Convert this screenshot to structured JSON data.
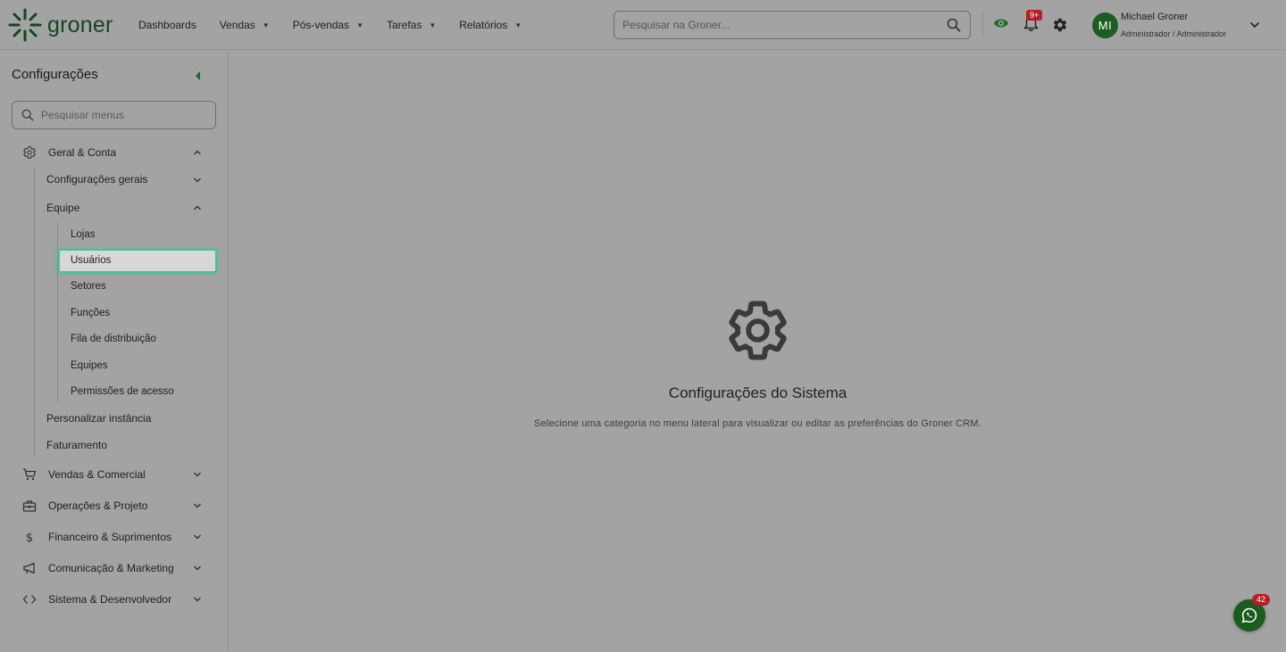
{
  "brand": {
    "name": "groner",
    "color": "#16461f"
  },
  "nav": {
    "items": [
      {
        "label": "Dashboards",
        "has_caret": false
      },
      {
        "label": "Vendas",
        "has_caret": true
      },
      {
        "label": "Pós-vendas",
        "has_caret": true
      },
      {
        "label": "Tarefas",
        "has_caret": true
      },
      {
        "label": "Relatórios",
        "has_caret": true
      }
    ]
  },
  "search": {
    "placeholder": "Pesquisar na Groner...",
    "icon": "search-icon"
  },
  "toolbar": {
    "notifications_badge": "9+",
    "icons": [
      "eye-icon",
      "bell-icon",
      "gear-icon"
    ]
  },
  "user": {
    "initials": "MI",
    "name": "Michael Groner",
    "role": "Administrador / Administrador"
  },
  "sidebar": {
    "title": "Configurações",
    "search_placeholder": "Pesquisar menus",
    "groups": [
      {
        "label": "Geral & Conta",
        "icon": "gear-icon",
        "expanded": true
      },
      {
        "label": "Vendas & Comercial",
        "icon": "cart-icon",
        "expanded": false
      },
      {
        "label": "Operações & Projeto",
        "icon": "toolbox-icon",
        "expanded": false
      },
      {
        "label": "Financeiro & Suprimentos",
        "icon": "dollar-icon",
        "expanded": false
      },
      {
        "label": "Comunicação & Marketing",
        "icon": "megaphone-icon",
        "expanded": false
      },
      {
        "label": "Sistema & Desenvolvedor",
        "icon": "code-icon",
        "expanded": false
      }
    ],
    "geral_sub": {
      "config_gerais": "Configurações gerais",
      "equipe": "Equipe",
      "personalizar": "Personalizar instância",
      "faturamento": "Faturamento"
    },
    "equipe_items": [
      "Lojas",
      "Usuários",
      "Setores",
      "Funções",
      "Fila de distribuição",
      "Equipes",
      "Permissões de acesso"
    ],
    "active_item": "Usuários"
  },
  "main": {
    "icon": "gear-icon",
    "title": "Configurações do Sistema",
    "subtitle": "Selecione uma categoria no menu lateral para visualizar ou editar as preferências do Groner CRM."
  },
  "chat_widget": {
    "icon": "whatsapp-icon",
    "badge": "42"
  },
  "colors": {
    "accent": "#1d6a22",
    "badge": "#b51f24",
    "active_border": "#3cc98a",
    "backdrop": "#a3a3a3"
  }
}
